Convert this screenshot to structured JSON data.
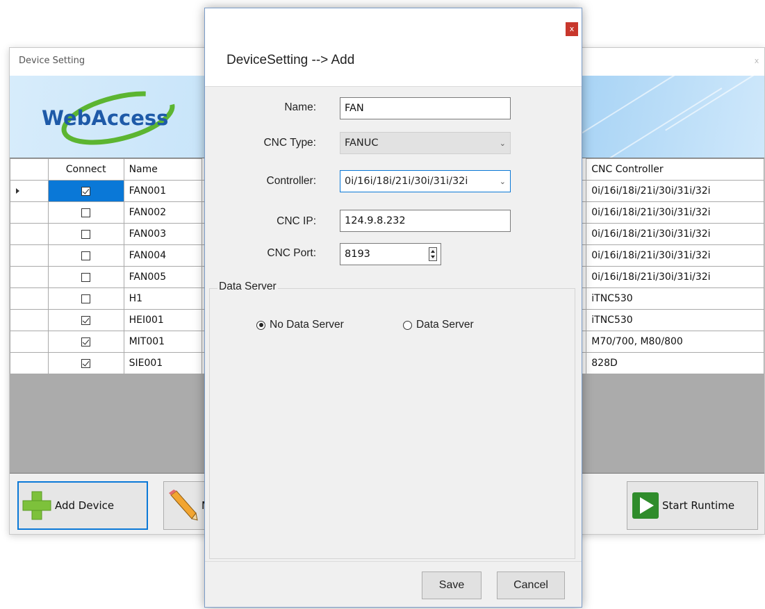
{
  "background_window": {
    "title": "Device Setting",
    "close_label": "x",
    "logo_text": "WebAccess",
    "table": {
      "headers": [
        "Connect",
        "Name",
        "CNC Controller"
      ],
      "rows": [
        {
          "connect": true,
          "name": "FAN001",
          "controller": "0i/16i/18i/21i/30i/31i/32i",
          "current": true
        },
        {
          "connect": false,
          "name": "FAN002",
          "controller": "0i/16i/18i/21i/30i/31i/32i"
        },
        {
          "connect": false,
          "name": "FAN003",
          "controller": "0i/16i/18i/21i/30i/31i/32i"
        },
        {
          "connect": false,
          "name": "FAN004",
          "controller": "0i/16i/18i/21i/30i/31i/32i"
        },
        {
          "connect": false,
          "name": "FAN005",
          "controller": "0i/16i/18i/21i/30i/31i/32i"
        },
        {
          "connect": false,
          "name": "H1",
          "controller": "iTNC530"
        },
        {
          "connect": true,
          "name": "HEI001",
          "controller": "iTNC530"
        },
        {
          "connect": true,
          "name": "MIT001",
          "controller": "M70/700, M80/800"
        },
        {
          "connect": true,
          "name": "SIE001",
          "controller": "828D"
        }
      ]
    },
    "buttons": {
      "add_device": "Add Device",
      "modify_partial": "M",
      "start_runtime": "Start Runtime"
    }
  },
  "dialog": {
    "close_label": "x",
    "heading": "DeviceSetting --> Add",
    "labels": {
      "name": "Name:",
      "cnc_type": "CNC Type:",
      "controller": "Controller:",
      "cnc_ip": "CNC IP:",
      "cnc_port": "CNC Port:"
    },
    "values": {
      "name": "FAN",
      "cnc_type": "FANUC",
      "controller": "0i/16i/18i/21i/30i/31i/32i",
      "cnc_ip": "124.9.8.232",
      "cnc_port": "8193"
    },
    "data_server": {
      "legend": "Data Server",
      "options": [
        "No Data Server",
        "Data Server"
      ],
      "selected_index": 0
    },
    "buttons": {
      "save": "Save",
      "cancel": "Cancel"
    }
  },
  "colors": {
    "selection_blue": "#0a78d7",
    "close_red": "#c8372c",
    "add_icon_green": "#7dc13b",
    "runtime_icon_green": "#3aa935",
    "logo_blue": "#1e5aa8",
    "logo_green": "#5cb531"
  }
}
